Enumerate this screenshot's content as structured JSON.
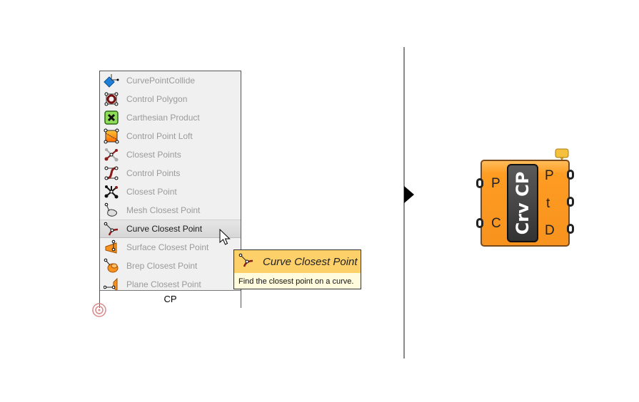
{
  "menu": {
    "items": [
      {
        "label": "CurvePointCollide",
        "icon": "curve-point-collide-icon",
        "highlighted": false
      },
      {
        "label": "Control Polygon",
        "icon": "control-polygon-icon",
        "highlighted": false
      },
      {
        "label": "Carthesian Product",
        "icon": "carthesian-product-icon",
        "highlighted": false
      },
      {
        "label": "Control Point Loft",
        "icon": "control-point-loft-icon",
        "highlighted": false
      },
      {
        "label": "Closest Points",
        "icon": "closest-points-icon",
        "highlighted": false
      },
      {
        "label": "Control Points",
        "icon": "control-points-icon",
        "highlighted": false
      },
      {
        "label": "Closest Point",
        "icon": "closest-point-icon",
        "highlighted": false
      },
      {
        "label": "Mesh Closest Point",
        "icon": "mesh-closest-point-icon",
        "highlighted": false
      },
      {
        "label": "Curve Closest Point",
        "icon": "curve-closest-point-icon",
        "highlighted": true
      },
      {
        "label": "Surface Closest Point",
        "icon": "surface-closest-point-icon",
        "highlighted": false
      },
      {
        "label": "Brep Closest Point",
        "icon": "brep-closest-point-icon",
        "highlighted": false
      },
      {
        "label": "Plane Closest Point",
        "icon": "plane-closest-point-icon",
        "highlighted": false
      }
    ],
    "search_value": "CP"
  },
  "tooltip": {
    "title": "Curve Closest Point",
    "description": "Find the closest point on a curve."
  },
  "component": {
    "nickname": "Crv CP",
    "inputs": [
      "P",
      "C"
    ],
    "outputs": [
      "P",
      "t",
      "D"
    ],
    "color": "#f7931e"
  }
}
